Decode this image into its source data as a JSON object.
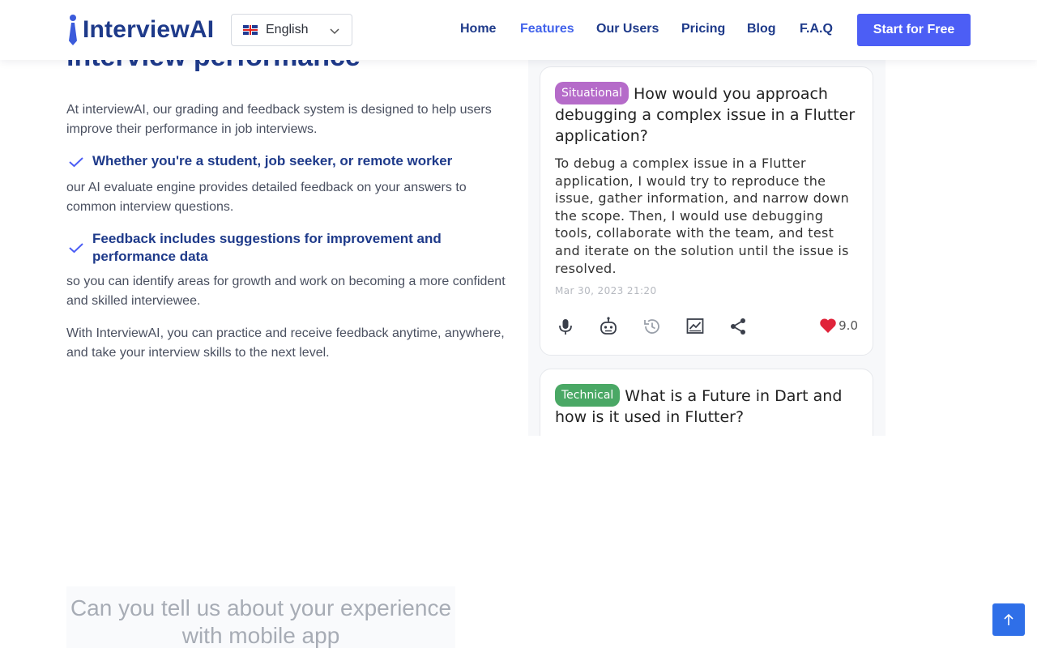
{
  "header": {
    "logo_text": "InterviewAI",
    "language": {
      "selected": "English",
      "flag": "uk-flag"
    },
    "nav": [
      {
        "label": "Home",
        "active": false
      },
      {
        "label": "Features",
        "active": true
      },
      {
        "label": "Our Users",
        "active": false
      },
      {
        "label": "Pricing",
        "active": false
      },
      {
        "label": "Blog",
        "active": false
      },
      {
        "label": "F.A.Q",
        "active": false
      }
    ],
    "cta_label": "Start for Free"
  },
  "feature": {
    "heading": "interview performance",
    "intro": "At interviewAI, our grading and feedback system is designed to help users improve their performance in job interviews.",
    "points": [
      {
        "title": "Whether you're a student, job seeker, or remote worker",
        "body": "our AI evaluate engine provides detailed feedback on your answers to common interview questions."
      },
      {
        "title": "Feedback includes suggestions for improvement and performance data",
        "body": "so you can identify areas for growth and work on becoming a more confident and skilled interviewee."
      }
    ],
    "closing": "With InterviewAI, you can practice and receive feedback anytime, anywhere, and take your interview skills to the next level."
  },
  "mock": {
    "cards": [
      {
        "tag": "Situational",
        "question": "How would you approach debugging a complex issue in a Flutter application?",
        "answer": "To debug a complex issue in a Flutter application, I would try to reproduce the issue, gather information, and narrow down the scope. Then, I would use debugging tools, collaborate with the team, and test and iterate on the solution until the issue is resolved.",
        "date": "Mar 30, 2023  21:20",
        "score": "9.0"
      },
      {
        "tag": "Technical",
        "question": "What is a Future in Dart and how is it used in Flutter?"
      }
    ]
  },
  "next_section": {
    "question": "Can you tell us about your experience with mobile app"
  },
  "colors": {
    "primary": "#4c5ef5",
    "navy": "#1e3a8a",
    "situational": "#b56bc9",
    "technical": "#4aa865",
    "heart": "#e0243a"
  }
}
